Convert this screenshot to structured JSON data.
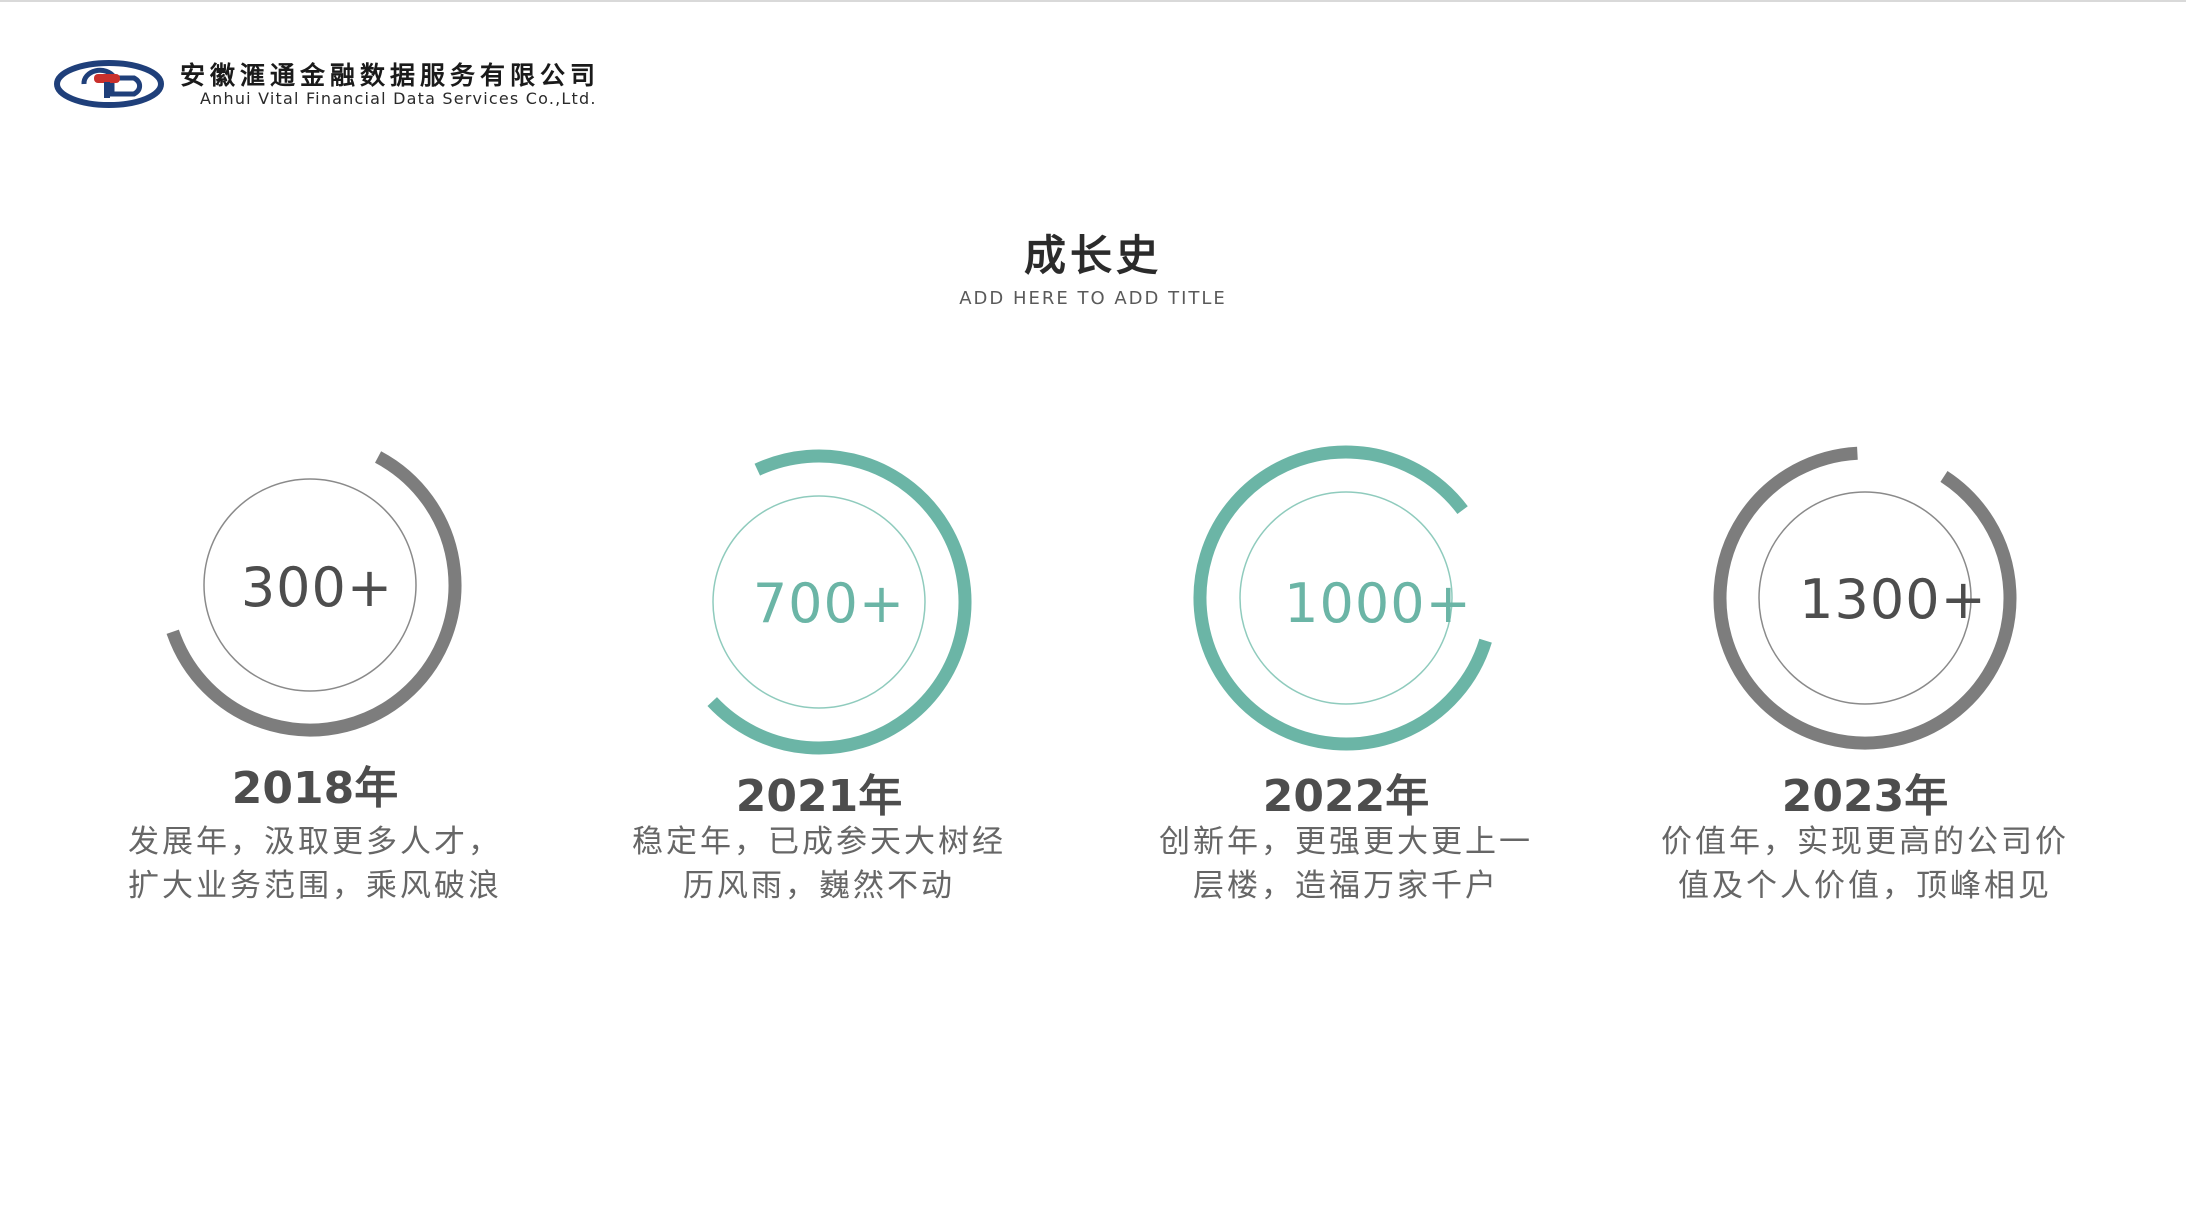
{
  "header": {
    "company_name_cn": "安徽滙通金融数据服务有限公司",
    "company_name_en": "Anhui Vital Financial Data Services Co.,Ltd.",
    "logo_icon": "company-logo-icon",
    "logo_colors": {
      "outer": "#1f3f7a",
      "accent": "#c9302c"
    }
  },
  "page": {
    "title": "成长史",
    "subtitle": "ADD HERE TO ADD TITLE"
  },
  "colors": {
    "teal": "#6bb5a6",
    "gray": "#7d7d7d",
    "thin_teal": "#8fcbbd",
    "thin_gray": "#8a8a8a",
    "text_dark": "#4d4d4d",
    "text_mid": "#666666"
  },
  "milestones": [
    {
      "value": "300+",
      "year": "2018年",
      "desc_line1": "发展年，汲取更多人才，",
      "desc_line2": "扩大业务范围，乘风破浪",
      "theme": "gray",
      "progress": 0.62
    },
    {
      "value": "700+",
      "year": "2021年",
      "desc_line1": "稳定年，已成参天大树经",
      "desc_line2": "历风雨，巍然不动",
      "theme": "teal",
      "progress": 0.7
    },
    {
      "value": "1000+",
      "year": "2022年",
      "desc_line1": "创新年，更强更大更上一",
      "desc_line2": "层楼，造福万家千户",
      "theme": "teal",
      "progress": 0.85
    },
    {
      "value": "1300+",
      "year": "2023年",
      "desc_line1": "价值年，实现更高的公司价",
      "desc_line2": "值及个人价值，顶峰相见",
      "theme": "gray",
      "progress": 0.9
    }
  ]
}
